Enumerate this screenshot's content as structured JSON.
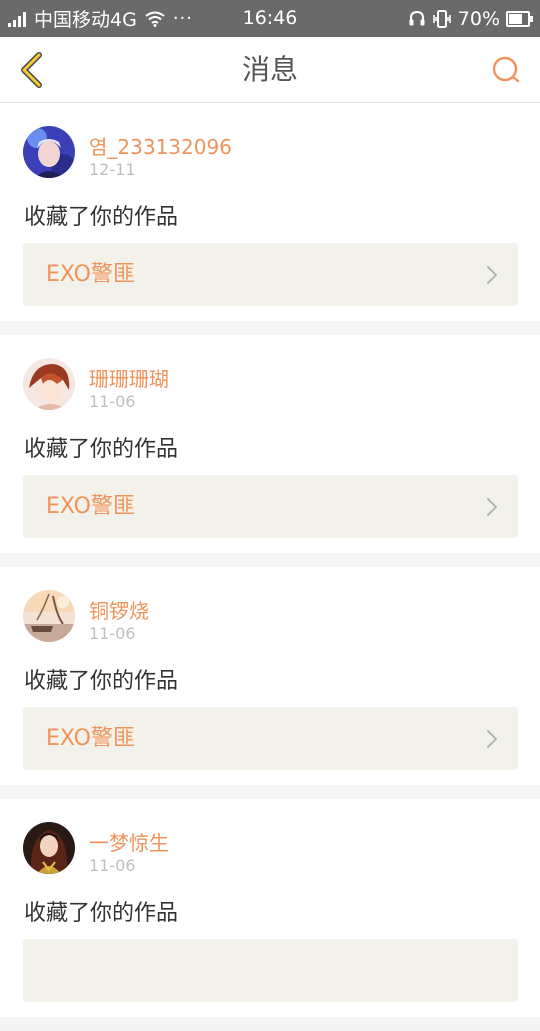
{
  "status_bar": {
    "carrier": "中国移动4G",
    "more": "···",
    "time": "16:46",
    "battery": "70%",
    "battery_level": 0.7
  },
  "nav": {
    "title": "消息",
    "accent_color": "#f0935b",
    "back_icon": "chevron-left-icon",
    "search_icon": "search-icon"
  },
  "messages": [
    {
      "user": "염_233132096",
      "date": "12-11",
      "action": "收藏了你的作品",
      "work": "EXO警匪"
    },
    {
      "user": "珊珊珊瑚",
      "date": "11-06",
      "action": "收藏了你的作品",
      "work": "EXO警匪"
    },
    {
      "user": "铜锣烧",
      "date": "11-06",
      "action": "收藏了你的作品",
      "work": "EXO警匪"
    },
    {
      "user": "一梦惊生",
      "date": "11-06",
      "action": "收藏了你的作品",
      "work": ""
    }
  ]
}
